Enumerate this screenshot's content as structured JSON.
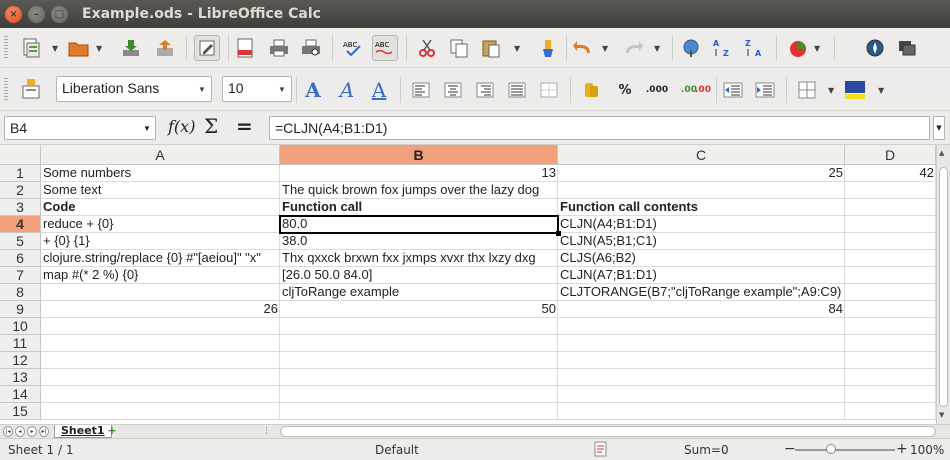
{
  "window": {
    "title": "Example.ods - LibreOffice Calc",
    "close_glyph": "×",
    "min_glyph": "–",
    "max_glyph": "□"
  },
  "toolbar_standard": {
    "icons": [
      "new-icon",
      "open-icon",
      "save-icon",
      "export-icon",
      "edit-mode-icon",
      "export-pdf-icon",
      "print-icon",
      "print-preview-icon",
      "spellcheck-icon",
      "autospellcheck-icon",
      "cut-icon",
      "copy-icon",
      "paste-icon",
      "clone-formatting-icon",
      "undo-icon",
      "redo-icon",
      "hyperlink-icon",
      "sort-ascending-icon",
      "sort-descending-icon",
      "chart-icon",
      "navigator-icon",
      "gallery-icon"
    ]
  },
  "toolbar_formatting": {
    "font_name": "Liberation Sans",
    "font_size": "10",
    "bold_glyph": "A",
    "italic_glyph": "A",
    "underline_glyph": "A",
    "percent_glyph": "%",
    "decimal_glyph": ".000",
    "decimal_add_glyph": ".00",
    "decimal_remove_glyph": ".00"
  },
  "formula_bar": {
    "name_box": "B4",
    "fx_label": "f(x)",
    "sum_label": "Σ",
    "equals_label": "=",
    "formula": "=CLJN(A4;B1:D1)"
  },
  "columns": [
    {
      "label": "A"
    },
    {
      "label": "B"
    },
    {
      "label": "C"
    },
    {
      "label": "D"
    }
  ],
  "active_column": "B",
  "active_row": 4,
  "rows": [
    {
      "num": "1",
      "cells": [
        {
          "col": 0,
          "text": "Some numbers"
        },
        {
          "col": 1,
          "text": "13",
          "num": true
        },
        {
          "col": 2,
          "text": "25",
          "num": true
        },
        {
          "col": 3,
          "text": "42",
          "num": true
        }
      ]
    },
    {
      "num": "2",
      "cells": [
        {
          "col": 0,
          "text": "Some text"
        },
        {
          "col": 1,
          "text": "The quick brown fox jumps over the lazy dog"
        }
      ]
    },
    {
      "num": "3",
      "cells": [
        {
          "col": 0,
          "text": "Code",
          "bold": true
        },
        {
          "col": 1,
          "text": "Function call",
          "bold": true
        },
        {
          "col": 2,
          "text": "Function call contents",
          "bold": true
        }
      ]
    },
    {
      "num": "4",
      "cells": [
        {
          "col": 0,
          "text": "reduce + {0}"
        },
        {
          "col": 1,
          "text": "80.0"
        },
        {
          "col": 2,
          "text": "CLJN(A4;B1:D1)"
        }
      ]
    },
    {
      "num": "5",
      "cells": [
        {
          "col": 0,
          "text": "+ {0} {1}"
        },
        {
          "col": 1,
          "text": "38.0"
        },
        {
          "col": 2,
          "text": "CLJN(A5;B1;C1)"
        }
      ]
    },
    {
      "num": "6",
      "cells": [
        {
          "col": 0,
          "text": "clojure.string/replace {0} #\"[aeiou]\" \"x\""
        },
        {
          "col": 1,
          "text": "Thx qxxck brxwn fxx jxmps xvxr thx lxzy dxg"
        },
        {
          "col": 2,
          "text": "CLJS(A6;B2)"
        }
      ]
    },
    {
      "num": "7",
      "cells": [
        {
          "col": 0,
          "text": "map #(* 2 %) {0}"
        },
        {
          "col": 1,
          "text": "[26.0 50.0 84.0]"
        },
        {
          "col": 2,
          "text": "CLJN(A7;B1:D1)"
        }
      ]
    },
    {
      "num": "8",
      "cells": [
        {
          "col": 1,
          "text": "cljToRange example"
        },
        {
          "col": 2,
          "text": "CLJTORANGE(B7;\"cljToRange example\";A9:C9)"
        }
      ]
    },
    {
      "num": "9",
      "cells": [
        {
          "col": 0,
          "text": "26",
          "num": true
        },
        {
          "col": 1,
          "text": "50",
          "num": true
        },
        {
          "col": 2,
          "text": "84",
          "num": true
        }
      ]
    },
    {
      "num": "10",
      "cells": []
    },
    {
      "num": "11",
      "cells": []
    },
    {
      "num": "12",
      "cells": []
    },
    {
      "num": "13",
      "cells": []
    },
    {
      "num": "14",
      "cells": []
    },
    {
      "num": "15",
      "cells": []
    }
  ],
  "sheet_tabs": {
    "active": "Sheet1",
    "add_glyph": "+",
    "nav": [
      "|◂",
      "◂",
      "▸",
      "▸|"
    ]
  },
  "status_bar": {
    "sheet": "Sheet 1 / 1",
    "style": "Default",
    "sum": "Sum=0",
    "zoom_minus": "−",
    "zoom_plus": "+",
    "zoom": "100%"
  },
  "colors": {
    "accent_header": "#f0a07a",
    "titlebar": "#3f3e3a",
    "close_button": "#df4a16"
  }
}
